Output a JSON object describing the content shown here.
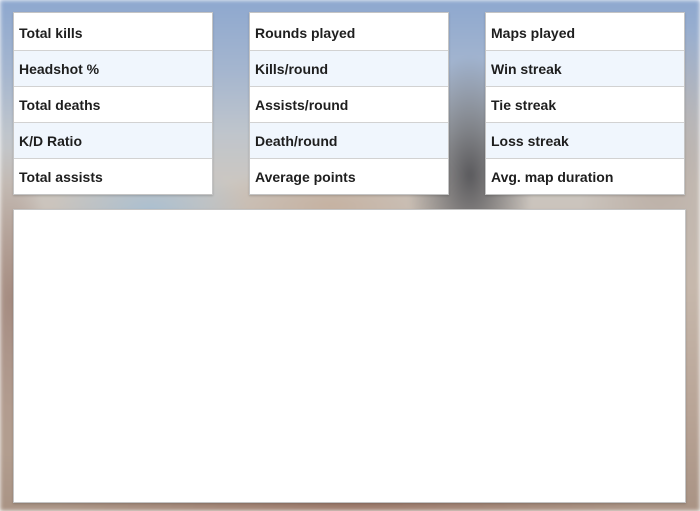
{
  "stats_cards": [
    {
      "rows": [
        {
          "label": "Total kills"
        },
        {
          "label": "Headshot %"
        },
        {
          "label": "Total deaths"
        },
        {
          "label": "K/D Ratio"
        },
        {
          "label": "Total assists"
        }
      ]
    },
    {
      "rows": [
        {
          "label": "Rounds played"
        },
        {
          "label": "Kills/round"
        },
        {
          "label": "Assists/round"
        },
        {
          "label": "Death/round"
        },
        {
          "label": "Average points"
        }
      ]
    },
    {
      "rows": [
        {
          "label": "Maps played"
        },
        {
          "label": "Win streak"
        },
        {
          "label": "Tie streak"
        },
        {
          "label": "Loss streak"
        },
        {
          "label": "Avg. map duration"
        }
      ]
    }
  ],
  "colors": {
    "row_alt_background": "#f0f6fd",
    "card_background": "#ffffff",
    "label_text": "#1e1e1e"
  }
}
